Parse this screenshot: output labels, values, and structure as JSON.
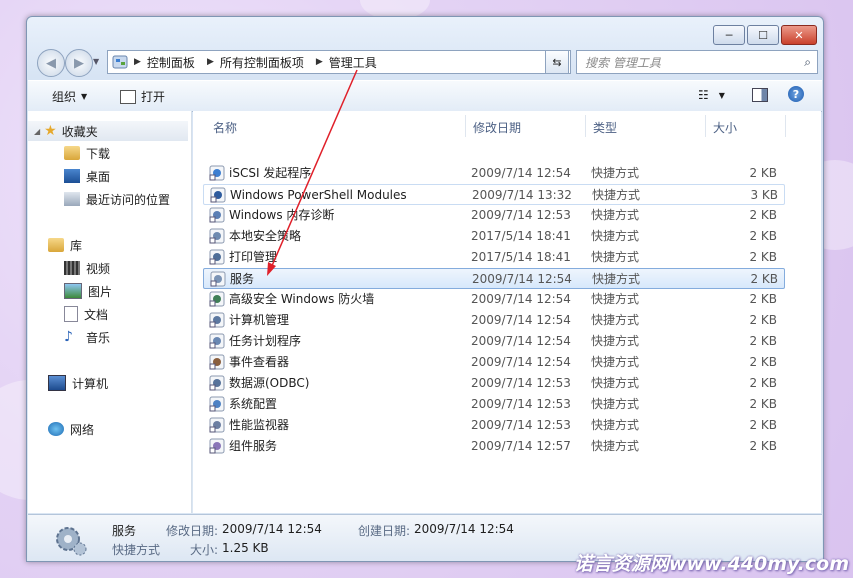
{
  "window": {
    "controls": {
      "minimize": "─",
      "maximize": "☐",
      "close": "✕"
    }
  },
  "address": {
    "crumbs": [
      "控制面板",
      "所有控制面板项",
      "管理工具"
    ],
    "search_placeholder": "搜索 管理工具"
  },
  "toolbar": {
    "organize": "组织",
    "open": "打开"
  },
  "nav": {
    "favorites": "收藏夹",
    "downloads": "下载",
    "desktop": "桌面",
    "recent": "最近访问的位置",
    "libraries": "库",
    "videos": "视频",
    "pictures": "图片",
    "documents": "文档",
    "music": "音乐",
    "computer": "计算机",
    "network": "网络"
  },
  "columns": {
    "name": "名称",
    "date": "修改日期",
    "type": "类型",
    "size": "大小"
  },
  "files": [
    {
      "name": "iSCSI 发起程序",
      "date": "2009/7/14 12:54",
      "type": "快捷方式",
      "size": "2 KB"
    },
    {
      "name": "Windows PowerShell Modules",
      "date": "2009/7/14 13:32",
      "type": "快捷方式",
      "size": "3 KB"
    },
    {
      "name": "Windows 内存诊断",
      "date": "2009/7/14 12:53",
      "type": "快捷方式",
      "size": "2 KB"
    },
    {
      "name": "本地安全策略",
      "date": "2017/5/14 18:41",
      "type": "快捷方式",
      "size": "2 KB"
    },
    {
      "name": "打印管理",
      "date": "2017/5/14 18:41",
      "type": "快捷方式",
      "size": "2 KB"
    },
    {
      "name": "服务",
      "date": "2009/7/14 12:54",
      "type": "快捷方式",
      "size": "2 KB"
    },
    {
      "name": "高级安全 Windows 防火墙",
      "date": "2009/7/14 12:54",
      "type": "快捷方式",
      "size": "2 KB"
    },
    {
      "name": "计算机管理",
      "date": "2009/7/14 12:54",
      "type": "快捷方式",
      "size": "2 KB"
    },
    {
      "name": "任务计划程序",
      "date": "2009/7/14 12:54",
      "type": "快捷方式",
      "size": "2 KB"
    },
    {
      "name": "事件查看器",
      "date": "2009/7/14 12:54",
      "type": "快捷方式",
      "size": "2 KB"
    },
    {
      "name": "数据源(ODBC)",
      "date": "2009/7/14 12:53",
      "type": "快捷方式",
      "size": "2 KB"
    },
    {
      "name": "系统配置",
      "date": "2009/7/14 12:53",
      "type": "快捷方式",
      "size": "2 KB"
    },
    {
      "name": "性能监视器",
      "date": "2009/7/14 12:53",
      "type": "快捷方式",
      "size": "2 KB"
    },
    {
      "name": "组件服务",
      "date": "2009/7/14 12:57",
      "type": "快捷方式",
      "size": "2 KB"
    }
  ],
  "details": {
    "name": "服务",
    "type": "快捷方式",
    "modified_label": "修改日期:",
    "modified": "2009/7/14 12:54",
    "created_label": "创建日期:",
    "created": "2009/7/14 12:54",
    "size_label": "大小:",
    "size": "1.25 KB"
  },
  "watermark": "诺言资源网www.440my.com",
  "colors": {
    "selection": "#d7e8fb",
    "arrow": "#e0202a"
  }
}
